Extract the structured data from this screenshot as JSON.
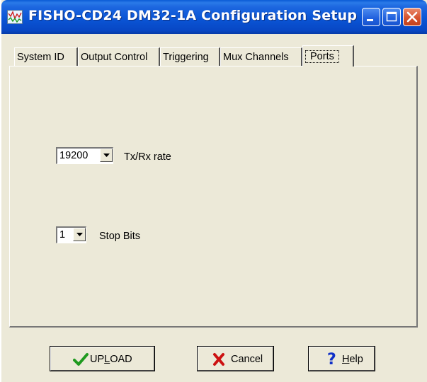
{
  "window": {
    "title": "FISHO-CD24 DM32-1A Configuration Setup",
    "controls": [
      "minimize-icon",
      "maximize-icon",
      "close-icon"
    ]
  },
  "tabs": [
    {
      "label": "System ID",
      "active": false
    },
    {
      "label": "Output Control",
      "active": false
    },
    {
      "label": "Triggering",
      "active": false
    },
    {
      "label": "Mux Channels",
      "active": false
    },
    {
      "label": "Ports",
      "active": true
    }
  ],
  "ports": {
    "rate_value": "19200",
    "rate_label": "Tx/Rx rate",
    "stopbits_value": "1",
    "stopbits_label": "Stop Bits"
  },
  "buttons": {
    "upload_pre": "UP",
    "upload_accel": "L",
    "upload_post": "OAD",
    "cancel": "Cancel",
    "help_accel": "H",
    "help_post": "elp"
  },
  "colors": {
    "titlebar": "#0a55d5",
    "close_button": "#d7532e",
    "dialog_background": "#ece9d8",
    "upload_check": "#1f9a1f",
    "cancel_x": "#cc1111",
    "help_question": "#1030c8"
  },
  "icons": {
    "app": "waveform-app-icon",
    "upload": "checkmark-icon",
    "cancel": "red-x-icon",
    "help": "question-mark-icon"
  }
}
